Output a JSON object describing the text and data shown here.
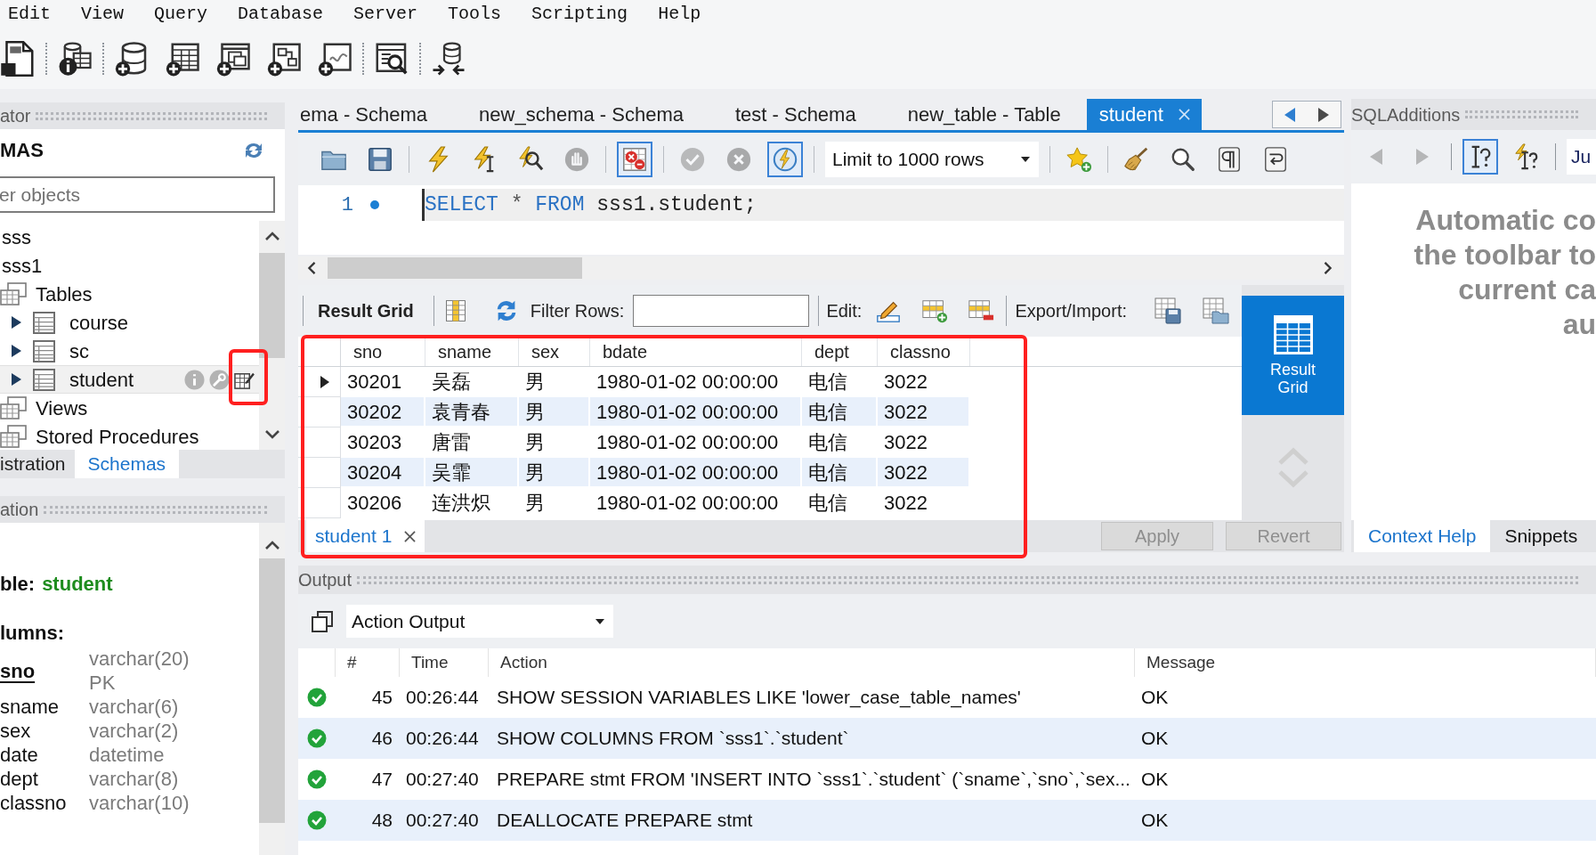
{
  "menu": [
    "Edit",
    "View",
    "Query",
    "Database",
    "Server",
    "Tools",
    "Scripting",
    "Help"
  ],
  "toolbar": [
    [
      {
        "kind": "document"
      }
    ],
    [
      {
        "kind": "database-info"
      }
    ],
    [
      {
        "kind": "database-add"
      },
      {
        "kind": "table-add"
      },
      {
        "kind": "windows-add"
      },
      {
        "kind": "diagram-add"
      },
      {
        "kind": "panel-add"
      }
    ],
    [
      {
        "kind": "table-search"
      }
    ],
    [
      {
        "kind": "database-plug"
      }
    ]
  ],
  "navigator": {
    "title": "ator",
    "heading": "MAS",
    "filter": {
      "placeholder": "er objects"
    },
    "tree": [
      {
        "kind": "schema",
        "label": "sss",
        "selected": false
      },
      {
        "kind": "schema",
        "label": "sss1",
        "selected": false,
        "children": [
          {
            "kind": "group",
            "label": "Tables",
            "selected": false,
            "children": [
              {
                "kind": "table",
                "label": "course",
                "expanded": false,
                "selected": false
              },
              {
                "kind": "table",
                "label": "sc",
                "expanded": false,
                "selected": false
              },
              {
                "kind": "table",
                "label": "student",
                "expanded": false,
                "selected": true
              }
            ]
          },
          {
            "kind": "group",
            "label": "Views",
            "selected": false
          },
          {
            "kind": "group",
            "label": "Stored Procedures",
            "selected": false
          }
        ]
      }
    ],
    "tabs": [
      {
        "label": "istration",
        "selected": false
      },
      {
        "label": "Schemas",
        "selected": true
      }
    ]
  },
  "information": {
    "title": "ation",
    "object_label": "ble:",
    "object_name": "student",
    "columns_heading": "lumns:",
    "columns": [
      {
        "name": "sno",
        "type": "varchar(20)",
        "key": "PK",
        "primary": true
      },
      {
        "name": "sname",
        "type": "varchar(6)",
        "primary": false
      },
      {
        "name": "sex",
        "type": "varchar(2)",
        "primary": false
      },
      {
        "name": "date",
        "type": "datetime",
        "primary": false
      },
      {
        "name": "dept",
        "type": "varchar(8)",
        "primary": false
      },
      {
        "name": "classno",
        "type": "varchar(10)",
        "primary": false
      }
    ]
  },
  "editor_tabs": [
    {
      "label": "ema - Schema",
      "selected": false
    },
    {
      "label": "new_schema - Schema",
      "selected": false
    },
    {
      "label": "test - Schema",
      "selected": false
    },
    {
      "label": "new_table - Table",
      "selected": false
    },
    {
      "label": "student",
      "selected": true
    }
  ],
  "editor_toolbar": {
    "left": [
      [
        {
          "kind": "folder",
          "pressed": false,
          "disabled": false
        },
        {
          "kind": "save",
          "pressed": false,
          "disabled": false
        }
      ],
      [
        {
          "kind": "lightning",
          "pressed": false,
          "disabled": false
        },
        {
          "kind": "lightning-cursor",
          "pressed": false,
          "disabled": false
        },
        {
          "kind": "lightning-magnifier",
          "pressed": false,
          "disabled": false
        },
        {
          "kind": "stop",
          "pressed": false,
          "disabled": true
        }
      ],
      [
        {
          "kind": "error-grid",
          "pressed": true,
          "disabled": false
        }
      ],
      [
        {
          "kind": "commit",
          "pressed": false,
          "disabled": true
        },
        {
          "kind": "rollback",
          "pressed": false,
          "disabled": true
        },
        {
          "kind": "autocommit",
          "pressed": true,
          "disabled": false
        }
      ]
    ],
    "limit": "Limit to 1000 rows",
    "right": [
      [
        {
          "kind": "star-add",
          "pressed": false,
          "disabled": false
        }
      ],
      [
        {
          "kind": "broom",
          "pressed": false,
          "disabled": false
        },
        {
          "kind": "search",
          "pressed": false,
          "disabled": false
        },
        {
          "kind": "pilcrow",
          "pressed": false,
          "disabled": false
        },
        {
          "kind": "wrap",
          "pressed": false,
          "disabled": false
        }
      ]
    ]
  },
  "editor": {
    "lines": [
      {
        "number": "1",
        "marker": true,
        "current": true,
        "tokens": [
          {
            "kind": "keyword",
            "text": "SELECT"
          },
          {
            "kind": "operator",
            "text": " * "
          },
          {
            "kind": "keyword",
            "text": "FROM"
          },
          {
            "kind": "identifier",
            "text": " sss1.student;"
          }
        ]
      }
    ]
  },
  "result": {
    "title": "Result Grid",
    "filter_label": "Filter Rows:",
    "edit_label": "Edit:",
    "export_label": "Export/Import:",
    "columns": [
      "sno",
      "sname",
      "sex",
      "bdate",
      "dept",
      "classno"
    ],
    "rows": [
      {
        "current": true,
        "cells": [
          "30201",
          "吴磊",
          "男",
          "1980-01-02 00:00:00",
          "电信",
          "3022"
        ]
      },
      {
        "current": false,
        "cells": [
          "30202",
          "袁青春",
          "男",
          "1980-01-02 00:00:00",
          "电信",
          "3022"
        ]
      },
      {
        "current": false,
        "cells": [
          "30203",
          "唐雷",
          "男",
          "1980-01-02 00:00:00",
          "电信",
          "3022"
        ]
      },
      {
        "current": false,
        "cells": [
          "30204",
          "吴霏",
          "男",
          "1980-01-02 00:00:00",
          "电信",
          "3022"
        ]
      },
      {
        "current": false,
        "cells": [
          "30206",
          "连洪炽",
          "男",
          "1980-01-02 00:00:00",
          "电信",
          "3022"
        ]
      }
    ],
    "tabs": [
      {
        "label": "student 1",
        "selected": true
      }
    ],
    "buttons": [
      {
        "label": "Apply",
        "disabled": true
      },
      {
        "label": "Revert",
        "disabled": true
      }
    ],
    "views": [
      {
        "label": "Result Grid",
        "selected": true
      }
    ]
  },
  "sql_additions": {
    "title": "SQLAdditions",
    "buttons": [
      [
        {
          "kind": "back",
          "pressed": false,
          "disabled": true
        },
        {
          "kind": "forward",
          "pressed": false,
          "disabled": true
        }
      ],
      [
        {
          "kind": "help-cursor",
          "pressed": true,
          "disabled": false
        },
        {
          "kind": "lightning-help",
          "pressed": false,
          "disabled": false
        }
      ]
    ],
    "jump": "Ju",
    "help_lines": [
      "Automatic co",
      "the toolbar to",
      "current ca",
      "au"
    ],
    "tabs": [
      {
        "label": "Context Help",
        "selected": true
      },
      {
        "label": "Snippets",
        "selected": false
      }
    ]
  },
  "output": {
    "title": "Output",
    "selector": "Action Output",
    "columns": [
      "#",
      "Time",
      "Action",
      "Message"
    ],
    "rows": [
      {
        "kind": "ok",
        "number": "45",
        "time": "00:26:44",
        "action": "SHOW SESSION VARIABLES LIKE 'lower_case_table_names'",
        "message": "OK"
      },
      {
        "kind": "ok",
        "number": "46",
        "time": "00:26:44",
        "action": "SHOW COLUMNS FROM `sss1`.`student`",
        "message": "OK"
      },
      {
        "kind": "ok",
        "number": "47",
        "time": "00:27:40",
        "action": "PREPARE stmt FROM 'INSERT INTO `sss1`.`student` (`sname`,`sno`,`sex...",
        "message": "OK"
      },
      {
        "kind": "ok",
        "number": "48",
        "time": "00:27:40",
        "action": "DEALLOCATE PREPARE stmt",
        "message": "OK"
      }
    ]
  }
}
